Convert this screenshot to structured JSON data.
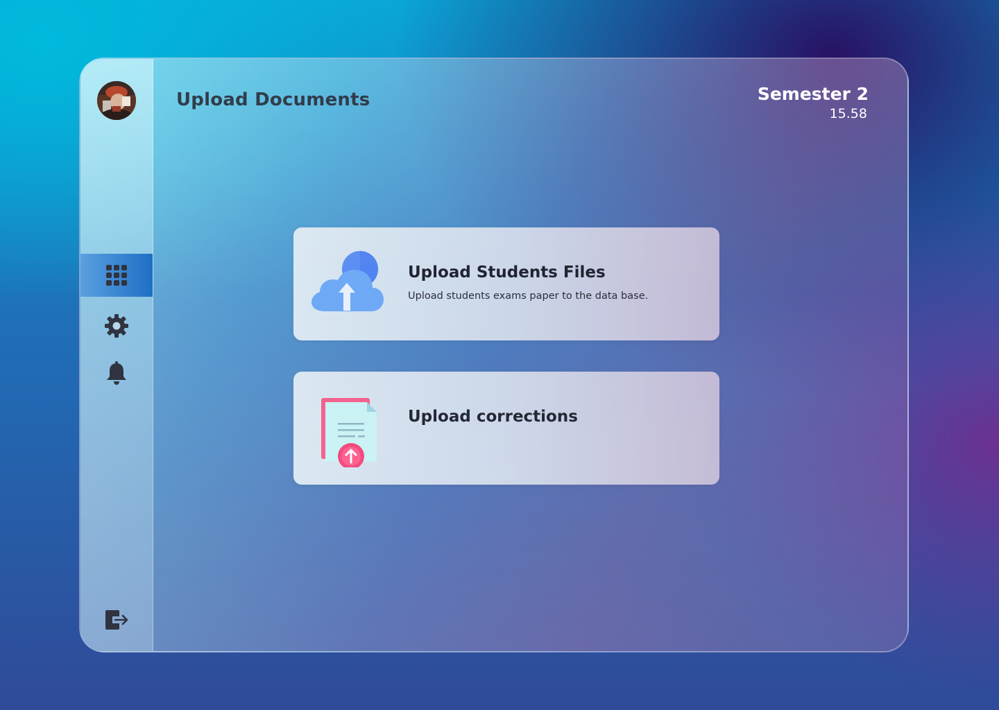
{
  "page": {
    "title": "Upload Documents"
  },
  "header": {
    "semester_label": "Semester 2",
    "time": "15.58"
  },
  "sidebar": {
    "avatar_icon": "user-avatar",
    "items": [
      {
        "id": "dashboard",
        "icon": "grid-icon",
        "active": true
      },
      {
        "id": "settings",
        "icon": "gear-icon",
        "active": false
      },
      {
        "id": "notifications",
        "icon": "bell-icon",
        "active": false
      }
    ],
    "logout_icon": "logout-icon"
  },
  "cards": [
    {
      "icon": "cloud-upload-icon",
      "title": "Upload Students Files",
      "description": "Upload students exams paper to the data base."
    },
    {
      "icon": "document-upload-icon",
      "title": "Upload corrections",
      "description": ""
    }
  ],
  "colors": {
    "active_nav": "#1e6fc4",
    "cloud_blue": "#6aa8f5",
    "upload_pink": "#f0457a"
  }
}
